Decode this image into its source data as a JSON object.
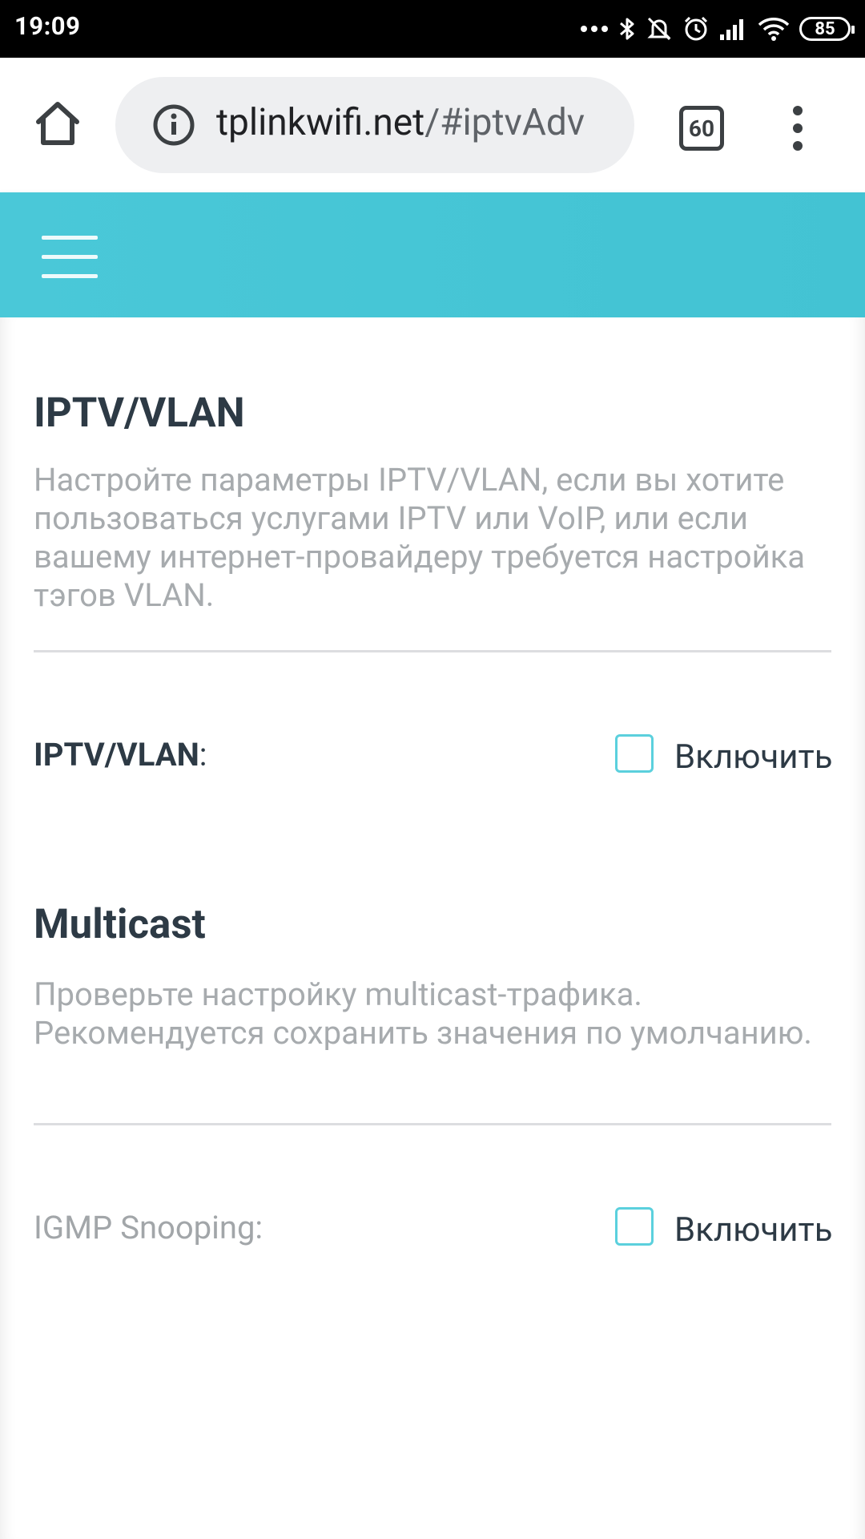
{
  "status_bar": {
    "time": "19:09",
    "battery": "85",
    "icons": [
      "more-dots-icon",
      "bluetooth-icon",
      "silent-bell-icon",
      "alarm-icon",
      "signal-icon",
      "wifi-icon",
      "battery-icon"
    ]
  },
  "browser": {
    "url_host": "tplinkwifi.net",
    "url_path": "/#iptvAdv",
    "tab_count": "60"
  },
  "sections": {
    "iptv": {
      "title": "IPTV/VLAN",
      "description": "Настройте параметры IPTV/VLAN, если вы хотите пользоваться услугами IPTV или VoIP, или если вашему интернет-провайдеру требуется настройка тэгов VLAN.",
      "field_label": "IPTV/VLAN",
      "field_suffix": ":",
      "checkbox_label": "Включить",
      "checked": false
    },
    "multicast": {
      "title": "Multicast",
      "description": "Проверьте настройку multicast-трафика. Рекомендуется сохранить значения по умолчанию.",
      "field_label": "IGMP Snooping:",
      "checkbox_label": "Включить",
      "checked": false
    }
  },
  "colors": {
    "header": "#45c5d5",
    "checkbox_border": "#5bd0dd",
    "title_text": "#2d3a45",
    "muted_text": "#a7abae"
  }
}
